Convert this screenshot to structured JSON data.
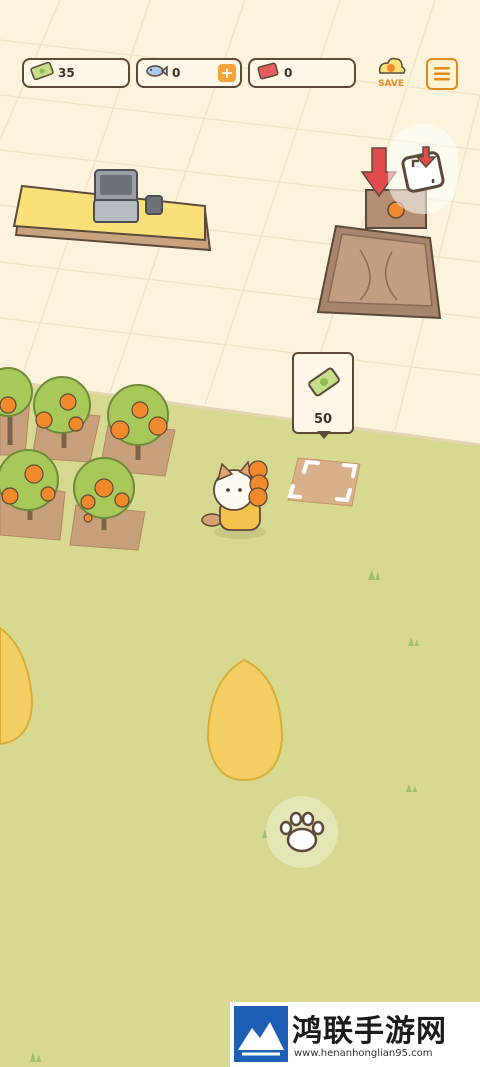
{
  "hud": {
    "cash": "35",
    "fish": "0",
    "tickets": "0",
    "fish_add": "+",
    "save_label": "SAVE"
  },
  "price_tag": {
    "price": "50"
  },
  "watermark": {
    "title": "鸿联手游网",
    "url": "www.henanhonglian95.com"
  },
  "icons": [
    "cash-icon",
    "fish-icon",
    "ticket-icon",
    "save-icon",
    "menu-icon",
    "storage-icon",
    "paw-icon"
  ],
  "colors": {
    "floor": "#fbf3dc",
    "grass": "#d6d98f",
    "orange": "#f08a2c",
    "counter": "#fbe07a",
    "outline": "#5b4a3a"
  }
}
